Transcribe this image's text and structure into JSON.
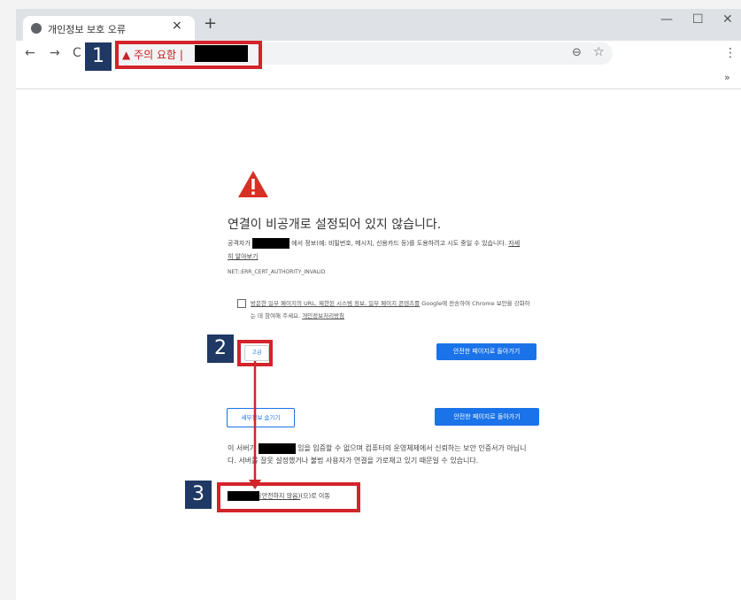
{
  "tab": {
    "title": "개인정보 보호 오류",
    "close": "×",
    "new_tab": "+"
  },
  "window_controls": {
    "minimize": "—",
    "maximize": "☐",
    "close": "✕"
  },
  "nav": {
    "back": "←",
    "forward": "→",
    "reload": "C"
  },
  "omnibox": {
    "warning_icon": "▲",
    "warning_text": "주의 요함",
    "separator": "|",
    "zoom_icon": "⊖",
    "star_icon": "☆"
  },
  "menu_icon": "⋮",
  "bookmarks_chevron": "»",
  "page": {
    "heading": "연결이 비공개로 설정되어 있지 않습니다.",
    "desc_prefix": "공격자가",
    "desc_middle": "에서 정보(예: 비밀번호, 메시지, 신용카드 등)를 도용하려고 시도 중일 수 있습니다.",
    "learn_more": "자세히 알아보기",
    "error_code": "NET::ERR_CERT_AUTHORITY_INVALID",
    "optin_link": "방문한 일부 페이지의 URL, 제한된 시스템 정보, 일부 페이지 콘텐츠를",
    "optin_text": "Google에 전송하여 Chrome 보안을 강화하는 데 참여해 주세요.",
    "privacy_link": "개인정보처리방침",
    "advanced_button": "고급",
    "back_button": "안전한 페이지로 돌아가기",
    "hide_details_button": "세부정보 숨기기",
    "back_button_2": "안전한 페이지로 돌아가기",
    "explain_prefix": "이 서버가",
    "explain_rest": "임을 입증할 수 없으며 컴퓨터의 운영체제에서 신뢰하는 보안 인증서가 아닙니다. 서버를 잘못 설정했거나 불법 사용자가 연결을 가로채고 있기 때문일 수 있습니다.",
    "proceed_link": "(안전하지 않음)",
    "proceed_suffix": "(으)로 이동"
  },
  "callouts": [
    {
      "number": "1"
    },
    {
      "number": "2"
    },
    {
      "number": "3"
    }
  ],
  "colors": {
    "callout_red": "#d3232b",
    "callout_badge": "#1f3864",
    "link_blue": "#1a73e8",
    "warning_red": "#c5221f"
  }
}
